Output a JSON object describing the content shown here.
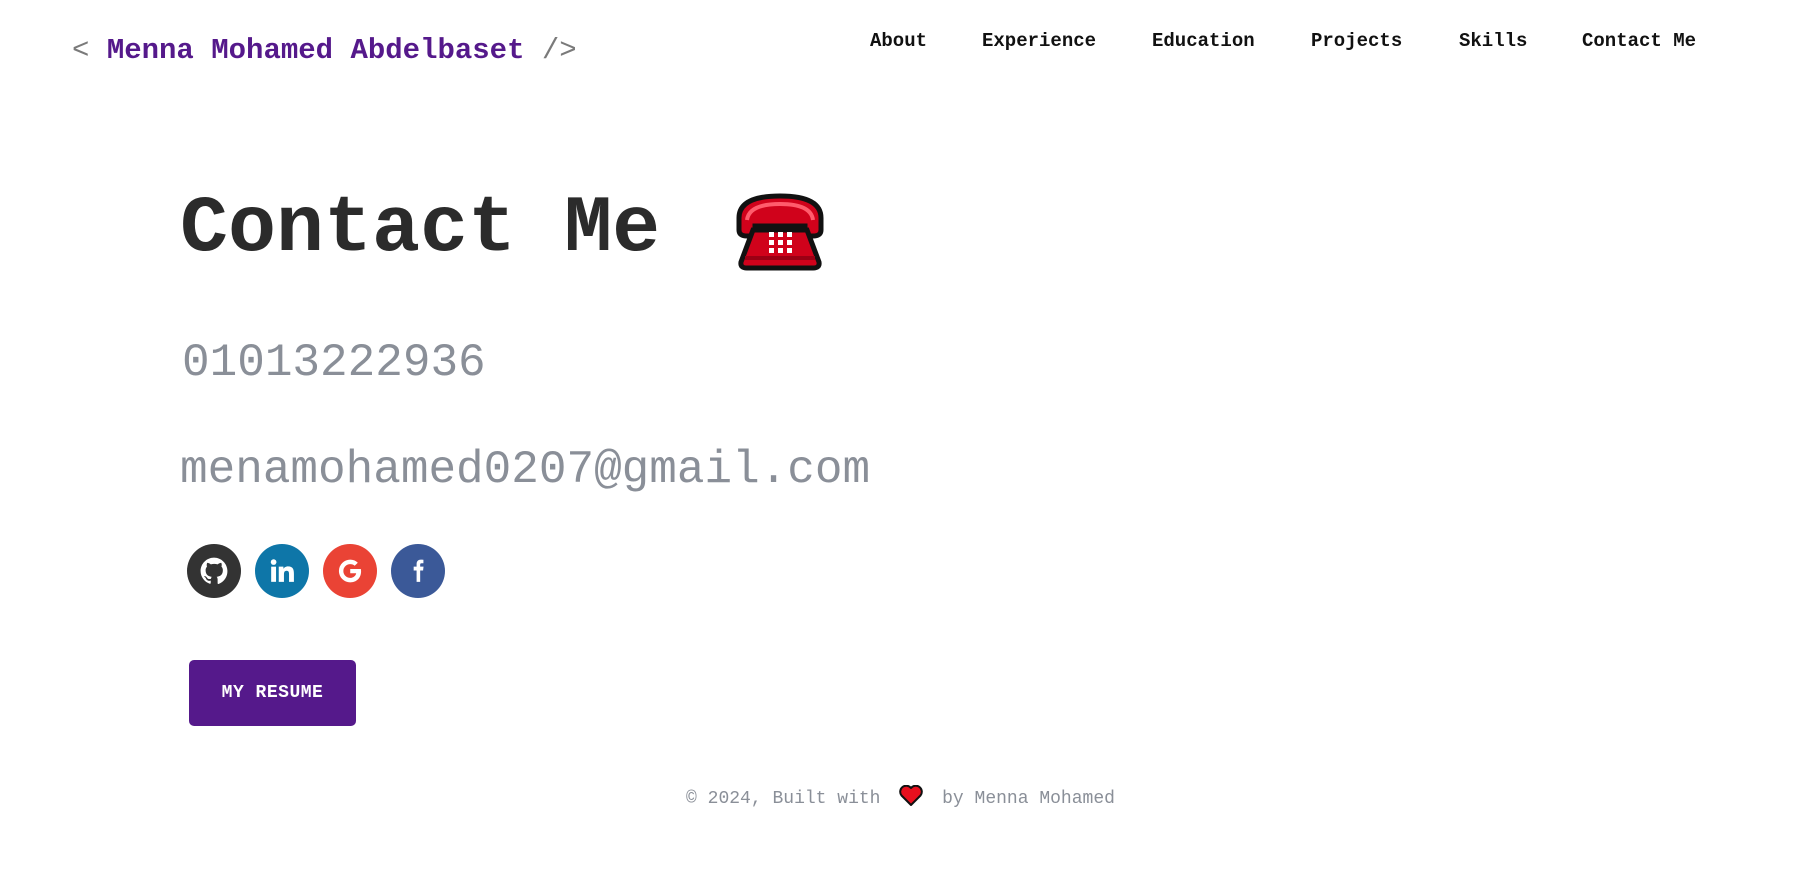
{
  "header": {
    "logo": {
      "open_bracket": "<",
      "name": "Menna Mohamed Abdelbaset",
      "close_bracket": "/>"
    },
    "nav": [
      "About",
      "Experience",
      "Education",
      "Projects",
      "Skills",
      "Contact Me"
    ]
  },
  "contact": {
    "title": "Contact Me",
    "title_icon": "telephone-icon",
    "phone": "01013222936",
    "email": "menamohamed0207@gmail.com",
    "socials": [
      {
        "name": "github-icon",
        "color": "#333333"
      },
      {
        "name": "linkedin-icon",
        "color": "#0e76a8"
      },
      {
        "name": "google-icon",
        "color": "#ea4335"
      },
      {
        "name": "facebook-icon",
        "color": "#3b5998"
      }
    ],
    "resume_label": "MY RESUME"
  },
  "footer": {
    "prefix": "© 2024, Built with",
    "icon": "heart-icon",
    "suffix": "by Menna Mohamed"
  },
  "colors": {
    "accent": "#55198b",
    "muted_text": "#8a8f98",
    "heading": "#2b2b2b"
  }
}
